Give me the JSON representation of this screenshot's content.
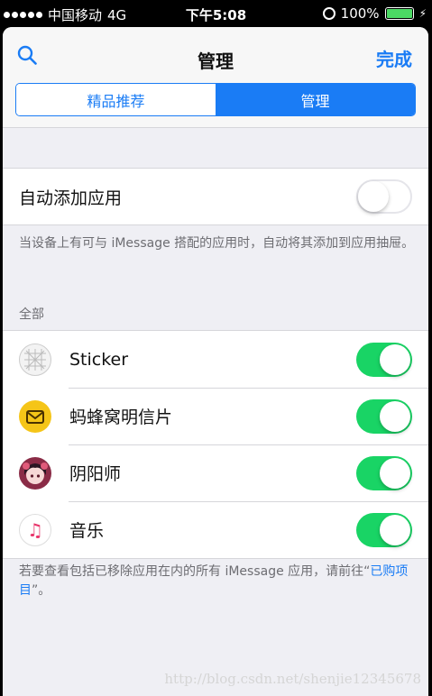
{
  "status_bar": {
    "carrier": "中国移动",
    "network": "4G",
    "time": "下午5:08",
    "battery": "100%"
  },
  "header": {
    "title": "管理",
    "done_label": "完成"
  },
  "tabs": [
    {
      "label": "精品推荐",
      "active": false
    },
    {
      "label": "管理",
      "active": true
    }
  ],
  "auto_add": {
    "label": "自动添加应用",
    "enabled": false,
    "note": "当设备上有可与 iMessage 搭配的应用时，自动将其添加到应用抽屉。"
  },
  "section_header": "全部",
  "apps": [
    {
      "name": "Sticker",
      "icon": "sticker-icon",
      "enabled": true
    },
    {
      "name": "蚂蜂窝明信片",
      "icon": "mafengwo-postcard-icon",
      "enabled": true
    },
    {
      "name": "阴阳师",
      "icon": "onmyoji-icon",
      "enabled": true
    },
    {
      "name": "音乐",
      "icon": "music-icon",
      "enabled": true
    }
  ],
  "footer": {
    "text_before": "若要查看包括已移除应用在内的所有 iMessage 应用，请前往“",
    "link": "已购项目",
    "text_after": "”。"
  },
  "watermark": "http://blog.csdn.net/shenjie12345678",
  "colors": {
    "accent": "#1a7cf5",
    "toggle_on": "#19d465",
    "background": "#efeff4"
  }
}
